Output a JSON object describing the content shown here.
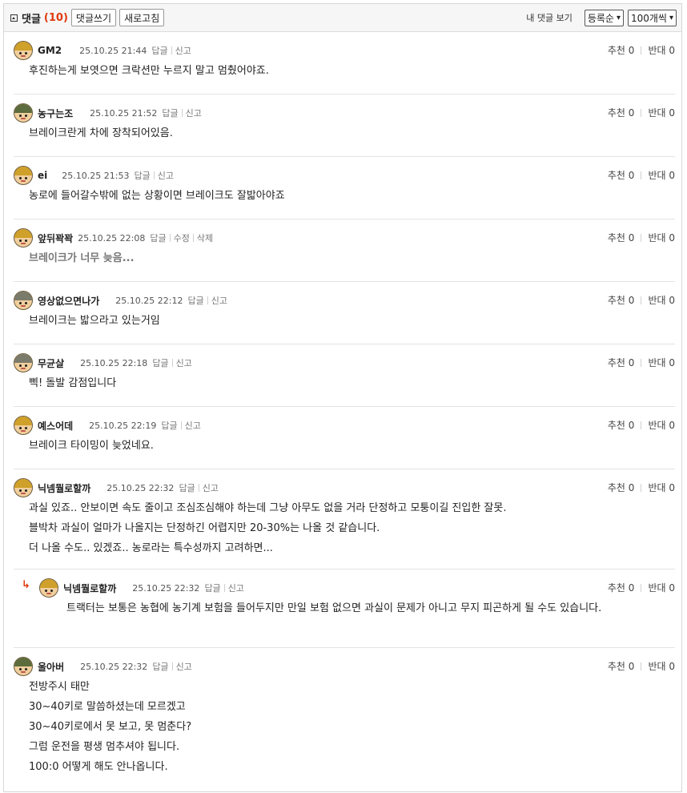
{
  "header": {
    "title": "댓글",
    "count": "(10)",
    "write_button": "댓글쓰기",
    "refresh_button": "새로고침",
    "my_comments": "내 댓글 보기",
    "sort_select": "등록순",
    "per_page_select": "100개씩"
  },
  "labels": {
    "reply": "답글",
    "report": "신고",
    "edit": "수정",
    "delete": "삭제",
    "recommend": "추천",
    "oppose": "반대"
  },
  "comments": [
    {
      "nick": "GM2",
      "date": "25.10.25 21:44",
      "up": "0",
      "down": "0",
      "lines": [
        "후진하는게 보엿으면 크락션만 누르지 말고 멈췄어야죠."
      ]
    },
    {
      "nick": "농구는조",
      "date": "25.10.25 21:52",
      "up": "0",
      "down": "0",
      "lines": [
        "브레이크란게 차에 장착되어있음."
      ]
    },
    {
      "nick": "ei",
      "date": "25.10.25 21:53",
      "up": "0",
      "down": "0",
      "lines": [
        "농로에 들어갈수밖에 없는 상황이면 브레이크도 잘밟아야죠"
      ]
    },
    {
      "nick": "앞뒤꽉꽉",
      "date": "25.10.25 22:08",
      "up": "0",
      "down": "0",
      "lines": [
        "브레이크가 너무 늦음..."
      ]
    },
    {
      "nick": "영상없으면나가",
      "date": "25.10.25 22:12",
      "up": "0",
      "down": "0",
      "lines": [
        "브레이크는 밟으라고 있는거임"
      ]
    },
    {
      "nick": "무균살",
      "date": "25.10.25 22:18",
      "up": "0",
      "down": "0",
      "lines": [
        "삑! 돌발 감점입니다"
      ]
    },
    {
      "nick": "예스어데",
      "date": "25.10.25 22:19",
      "up": "0",
      "down": "0",
      "lines": [
        "브레이크 타이밍이 늦었네요."
      ]
    },
    {
      "nick": "닉넴뭘로할까",
      "date": "25.10.25 22:32",
      "up": "0",
      "down": "0",
      "lines": [
        "과실 있죠.. 안보이면 속도 줄이고 조심조심해야 하는데 그냥 아무도 없을 거라 단정하고 모퉁이길 진입한 잘못.",
        "블박차 과실이 얼마가 나올지는 단정하긴 어렵지만 20-30%는 나올 것 같습니다.",
        "더 나올 수도.. 있겠죠.. 농로라는 특수성까지 고려하면..."
      ]
    },
    {
      "nick": "닉넴뭘로할까",
      "date": "25.10.25 22:32",
      "up": "0",
      "down": "0",
      "lines": [
        "트랙터는 보통은 농협에 농기계 보험을 들어두지만 만일 보험 없으면 과실이 문제가 아니고 무지 피곤하게 될 수도 있습니다."
      ]
    },
    {
      "nick": "울아버",
      "date": "25.10.25 22:32",
      "up": "0",
      "down": "0",
      "lines": [
        "전방주시 태만",
        "30~40키로 말씀하셨는데 모르겠고",
        "30~40키로에서 못 보고, 못 멈춘다?",
        "그럼 운전을 평생 멈추셔야 됩니다.",
        "100:0 어떻게 해도 안나옵니다."
      ]
    }
  ]
}
